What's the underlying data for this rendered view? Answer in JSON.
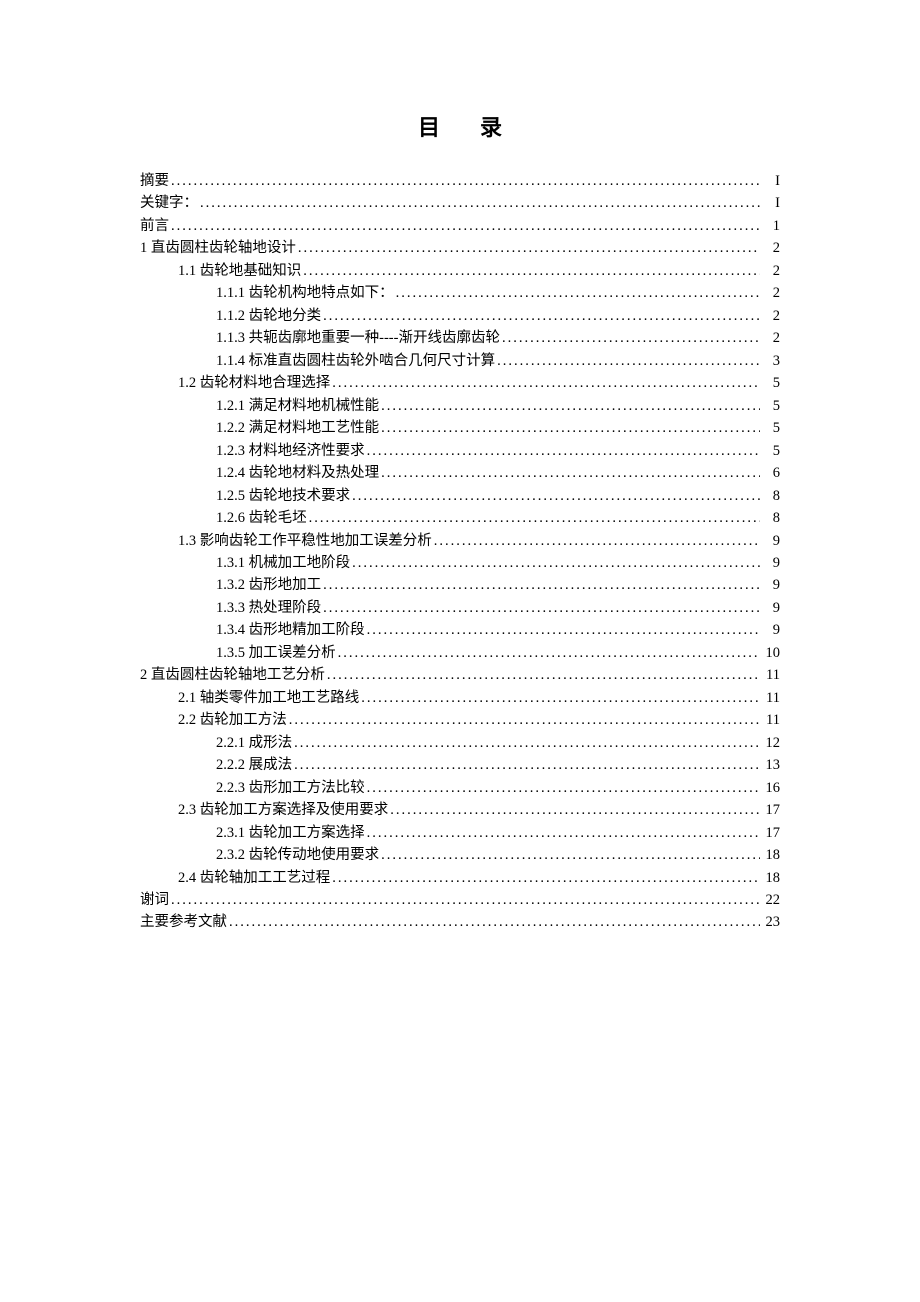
{
  "title": "目录",
  "toc": [
    {
      "level": 0,
      "label": "摘要",
      "page": "I"
    },
    {
      "level": 0,
      "label": "关键字：",
      "page": "I"
    },
    {
      "level": 0,
      "label": "前言",
      "page": "1"
    },
    {
      "level": 0,
      "label": "1 直齿圆柱齿轮轴地设计",
      "page": "2"
    },
    {
      "level": 1,
      "label": "1.1 齿轮地基础知识",
      "page": "2"
    },
    {
      "level": 2,
      "label": "1.1.1 齿轮机构地特点如下：",
      "page": "2"
    },
    {
      "level": 2,
      "label": "1.1.2 齿轮地分类",
      "page": "2"
    },
    {
      "level": 2,
      "label": "1.1.3 共轭齿廓地重要一种----渐开线齿廓齿轮",
      "page": "2"
    },
    {
      "level": 2,
      "label": "1.1.4 标准直齿圆柱齿轮外啮合几何尺寸计算",
      "page": "3"
    },
    {
      "level": 1,
      "label": "1.2 齿轮材料地合理选择",
      "page": "5"
    },
    {
      "level": 2,
      "label": "1.2.1 满足材料地机械性能",
      "page": "5"
    },
    {
      "level": 2,
      "label": "1.2.2 满足材料地工艺性能",
      "page": "5"
    },
    {
      "level": 2,
      "label": "1.2.3 材料地经济性要求",
      "page": "5"
    },
    {
      "level": 2,
      "label": "1.2.4 齿轮地材料及热处理",
      "page": "6"
    },
    {
      "level": 2,
      "label": "1.2.5 齿轮地技术要求",
      "page": "8"
    },
    {
      "level": 2,
      "label": "1.2.6 齿轮毛坯",
      "page": "8"
    },
    {
      "level": 1,
      "label": "1.3 影响齿轮工作平稳性地加工误差分析",
      "page": "9"
    },
    {
      "level": 2,
      "label": "1.3.1 机械加工地阶段",
      "page": "9"
    },
    {
      "level": 2,
      "label": "1.3.2 齿形地加工",
      "page": "9"
    },
    {
      "level": 2,
      "label": "1.3.3 热处理阶段",
      "page": "9"
    },
    {
      "level": 2,
      "label": "1.3.4 齿形地精加工阶段",
      "page": "9"
    },
    {
      "level": 2,
      "label": "1.3.5 加工误差分析",
      "page": "10"
    },
    {
      "level": 0,
      "label": "2 直齿圆柱齿轮轴地工艺分析",
      "page": "11"
    },
    {
      "level": 1,
      "label": "2.1 轴类零件加工地工艺路线",
      "page": "11"
    },
    {
      "level": 1,
      "label": "2.2 齿轮加工方法",
      "page": "11"
    },
    {
      "level": 2,
      "label": "2.2.1 成形法",
      "page": "12"
    },
    {
      "level": 2,
      "label": "2.2.2 展成法",
      "page": "13"
    },
    {
      "level": 2,
      "label": "2.2.3 齿形加工方法比较",
      "page": "16"
    },
    {
      "level": 1,
      "label": "2.3 齿轮加工方案选择及使用要求",
      "page": "17"
    },
    {
      "level": 2,
      "label": "2.3.1 齿轮加工方案选择",
      "page": "17"
    },
    {
      "level": 2,
      "label": "2.3.2 齿轮传动地使用要求",
      "page": "18"
    },
    {
      "level": 1,
      "label": "2.4 齿轮轴加工工艺过程",
      "page": "18"
    },
    {
      "level": 0,
      "label": "谢词",
      "page": "22"
    },
    {
      "level": 0,
      "label": "主要参考文献",
      "page": "23"
    }
  ]
}
